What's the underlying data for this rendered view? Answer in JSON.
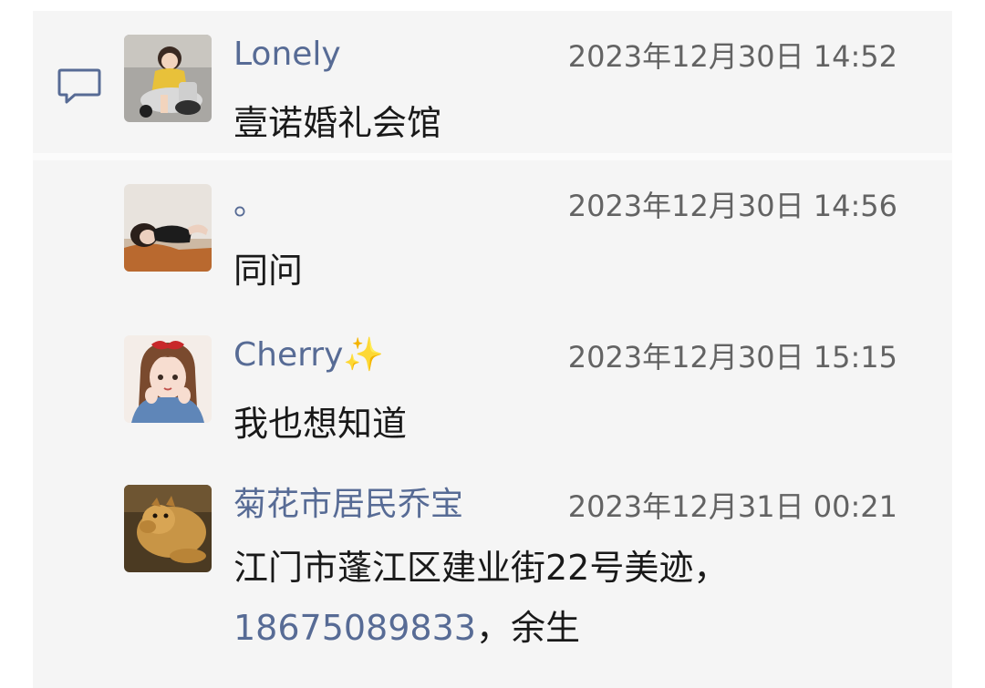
{
  "comments": [
    {
      "username": "Lonely",
      "timestamp": "2023年12月30日 14:52",
      "text": "壹诺婚礼会馆",
      "avatar": "toddler-on-ride-on-car-avatar"
    },
    {
      "username": "。",
      "timestamp": "2023年12月30日 14:56",
      "text": "同问",
      "avatar": "woman-lying-on-sofa-avatar"
    },
    {
      "username": "Cherry✨",
      "timestamp": "2023年12月30日 15:15",
      "text": "我也想知道",
      "avatar": "cartoon-girl-red-bow-avatar"
    },
    {
      "username": "菊花市居民乔宝",
      "timestamp": "2023年12月31日 00:21",
      "text": "江门市蓬江区建业街22号美迹，",
      "phone": "18675089833",
      "text_after_phone": "，余生",
      "avatar": "dog-photo-avatar"
    }
  ],
  "icons": {
    "comment_icon": "speech-bubble-icon"
  },
  "colors": {
    "username": "#576b95",
    "timestamp": "#636363",
    "text": "#191919",
    "panel_background": "#f5f5f5"
  }
}
